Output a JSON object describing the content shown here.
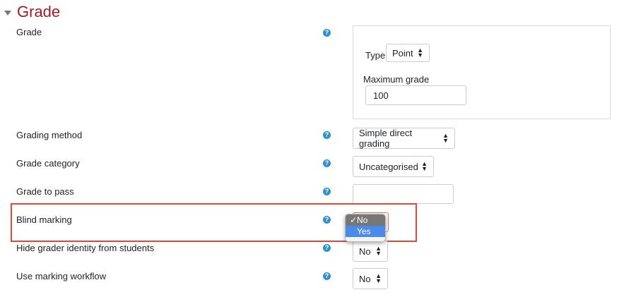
{
  "section": {
    "title": "Grade"
  },
  "rows": {
    "grade": {
      "label": "Grade"
    },
    "grading_method": {
      "label": "Grading method",
      "value": "Simple direct grading"
    },
    "grade_category": {
      "label": "Grade category",
      "value": "Uncategorised"
    },
    "grade_to_pass": {
      "label": "Grade to pass",
      "value": ""
    },
    "blind_marking": {
      "label": "Blind marking"
    },
    "hide_grader": {
      "label": "Hide grader identity from students",
      "value": "No"
    },
    "marking_workflow": {
      "label": "Use marking workflow",
      "value": "No"
    }
  },
  "grade_box": {
    "type_label": "Type",
    "type_value": "Point",
    "max_label": "Maximum grade",
    "max_value": "100"
  },
  "dropdown": {
    "options": [
      {
        "label": "No",
        "selected": true
      },
      {
        "label": "Yes",
        "highlighted": true
      }
    ]
  },
  "icons": {
    "help": "help-icon",
    "collapse": "caret-down-icon",
    "select": "updown-arrows-icon",
    "check": "checkmark-icon"
  },
  "colors": {
    "title": "#a31b28",
    "help": "#2f8fd0",
    "highlight_border": "#e0483a",
    "dropdown_highlight": "#4a8ae8"
  }
}
